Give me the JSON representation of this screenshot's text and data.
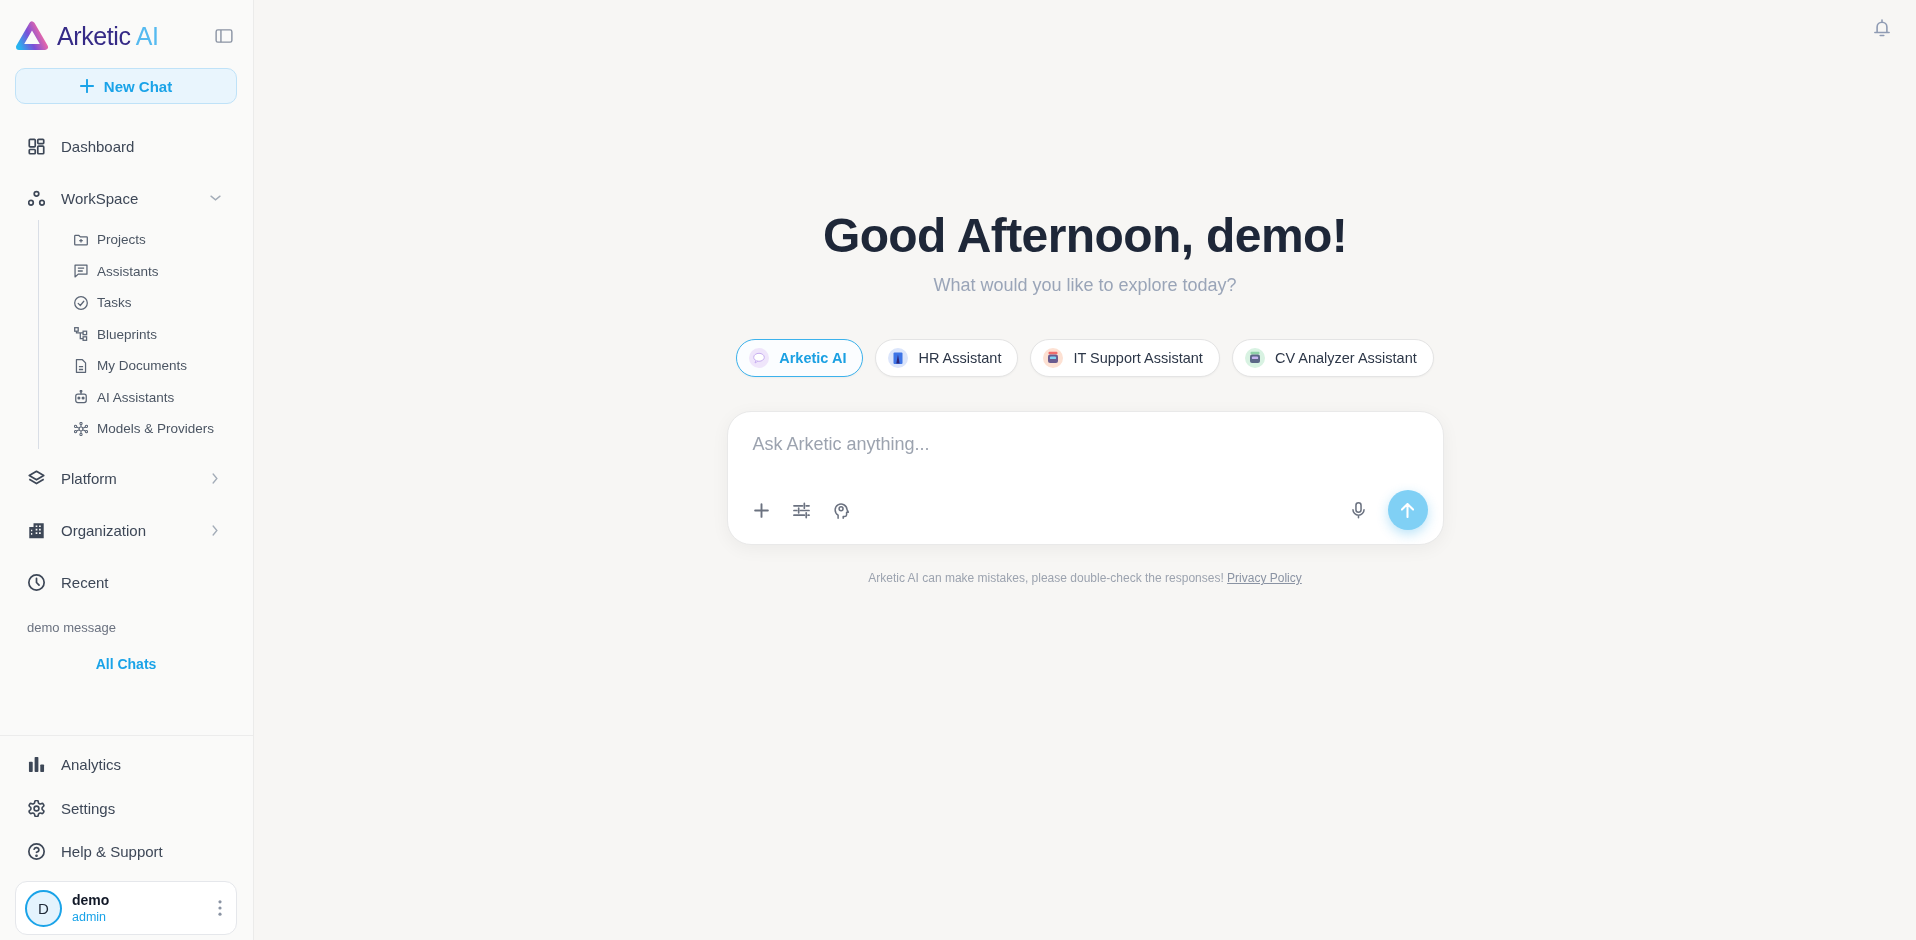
{
  "sidebar": {
    "brand": {
      "name": "Arketic",
      "accent": "AI"
    },
    "new_chat": {
      "label": "New Chat"
    },
    "nav": [
      {
        "label": "Dashboard",
        "kind": "link"
      },
      {
        "label": "WorkSpace",
        "kind": "group",
        "expanded": true,
        "children": [
          {
            "label": "Projects"
          },
          {
            "label": "Assistants"
          },
          {
            "label": "Tasks"
          },
          {
            "label": "Blueprints"
          },
          {
            "label": "My Documents"
          },
          {
            "label": "AI Assistants"
          },
          {
            "label": "Models & Providers"
          }
        ]
      },
      {
        "label": "Platform",
        "kind": "group",
        "expanded": false
      },
      {
        "label": "Organization",
        "kind": "group",
        "expanded": false
      },
      {
        "label": "Recent",
        "kind": "link"
      }
    ],
    "recent_chats": [
      "demo message"
    ],
    "all_chats_link": "All Chats",
    "footer_nav": [
      {
        "label": "Analytics"
      },
      {
        "label": "Settings"
      },
      {
        "label": "Help & Support"
      }
    ],
    "user": {
      "initial": "D",
      "name": "demo",
      "role": "admin"
    }
  },
  "main": {
    "greeting": "Good Afternoon, demo!",
    "subtitle": "What would you like to explore today?",
    "assistants": [
      {
        "label": "Arketic AI",
        "selected": true
      },
      {
        "label": "HR Assistant",
        "selected": false
      },
      {
        "label": "IT Support Assistant",
        "selected": false
      },
      {
        "label": "CV Analyzer Assistant",
        "selected": false
      }
    ],
    "composer": {
      "placeholder": "Ask Arketic anything...",
      "send_disabled": true
    },
    "disclaimer": {
      "text": "Arketic AI can make mistakes, please double-check the responses!",
      "link": "Privacy Policy"
    }
  }
}
